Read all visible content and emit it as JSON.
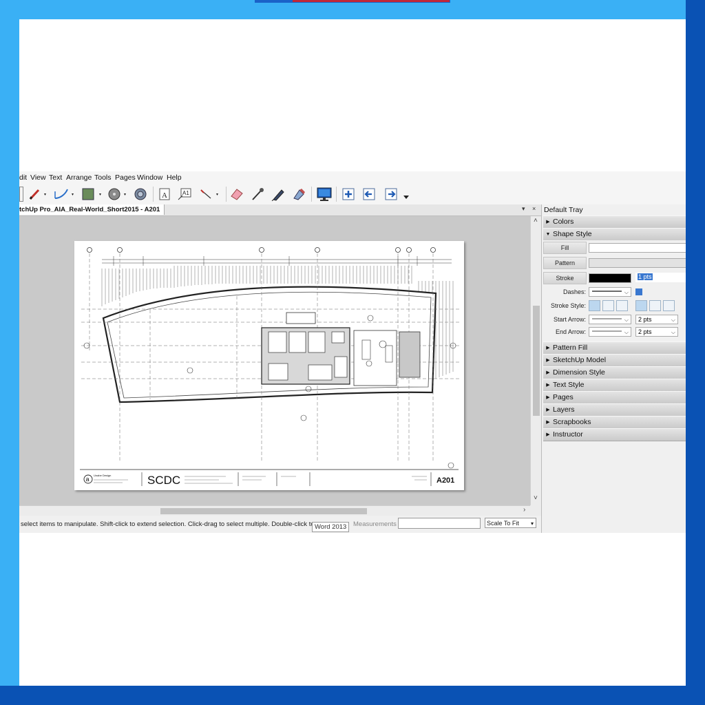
{
  "menu": {
    "items": [
      "dit",
      "View",
      "Text",
      "Arrange",
      "Tools",
      "Pages",
      "Window",
      "Help"
    ]
  },
  "toolbar": {
    "icons": [
      "select-arrow-icon",
      "pencil-icon",
      "freehand-icon",
      "shape-icon",
      "circle-icon",
      "offset-icon",
      "text-icon",
      "label-icon",
      "dimension-icon",
      "eraser-icon",
      "eyedropper-icon",
      "split-icon",
      "join-icon",
      "presentation-icon",
      "add-page-icon",
      "previous-page-icon",
      "next-page-icon"
    ]
  },
  "document": {
    "tab_title": "tchUp Pro_AIA_Real-World_Short2015 - A201",
    "ctrl_menu": "▾",
    "ctrl_close": "×"
  },
  "titleblock": {
    "firm_logo": "a",
    "firm_name": "Unabe Design",
    "project_logo": "SCDC",
    "sheet_number": "A201"
  },
  "status": {
    "hint": "select items to manipulate. Shift-click to extend selection. Click-drag to select multiple. Double-click to open editor.",
    "word_tooltip": "Word 2013",
    "measurements_label": "Measurements",
    "measurements_value": "",
    "scale_value": "Scale To Fit"
  },
  "tray": {
    "title": "Default Tray",
    "panels": {
      "colors": "Colors",
      "shape_style": "Shape Style",
      "pattern_fill": "Pattern Fill",
      "sketchup_model": "SketchUp Model",
      "dimension_style": "Dimension Style",
      "text_style": "Text Style",
      "pages": "Pages",
      "layers": "Layers",
      "scrapbooks": "Scrapbooks",
      "instructor": "Instructor"
    },
    "shape_style": {
      "fill_label": "Fill",
      "pattern_label": "Pattern",
      "stroke_label": "Stroke",
      "stroke_color": "#000000",
      "stroke_width": "1 pts",
      "dashes_label": "Dashes:",
      "stroke_style_label": "Stroke Style:",
      "start_arrow_label": "Start Arrow:",
      "start_arrow_size": "2 pts",
      "end_arrow_label": "End Arrow:",
      "end_arrow_size": "2 pts"
    }
  }
}
